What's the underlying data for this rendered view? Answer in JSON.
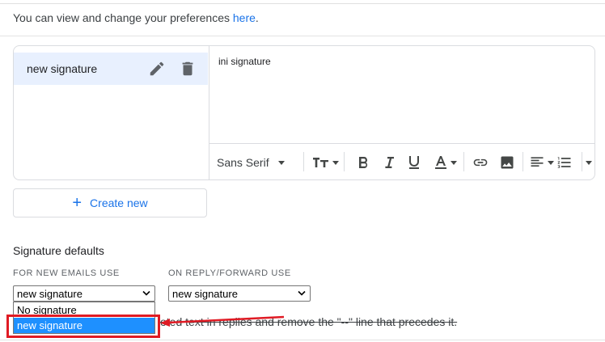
{
  "preferences": {
    "text": "You can view and change your preferences ",
    "link": "here",
    "end": "."
  },
  "signatures": {
    "items": [
      {
        "label": "new signature"
      }
    ],
    "editor_text": "ini signature"
  },
  "toolbar": {
    "font": "Sans Serif",
    "icons": [
      "font-size-icon",
      "bold-icon",
      "italic-icon",
      "underline-icon",
      "text-color-icon",
      "link-icon",
      "image-icon",
      "align-icon",
      "list-icon",
      "more-icon"
    ]
  },
  "create_new": {
    "label": "Create new"
  },
  "defaults": {
    "title": "Signature defaults",
    "new_emails_label": "FOR NEW EMAILS USE",
    "reply_label": "ON REPLY/FORWARD USE",
    "new_emails_value": "new signature",
    "reply_value": "new signature",
    "options": [
      "No signature",
      "new signature"
    ],
    "note_visible": "oted text in replies and remove the \"--\" line that precedes it."
  },
  "colors": {
    "accent": "#1a73e8",
    "selected_row": "#e8f0fe",
    "highlight": "#1e90ff",
    "annotation": "#e01b24"
  }
}
